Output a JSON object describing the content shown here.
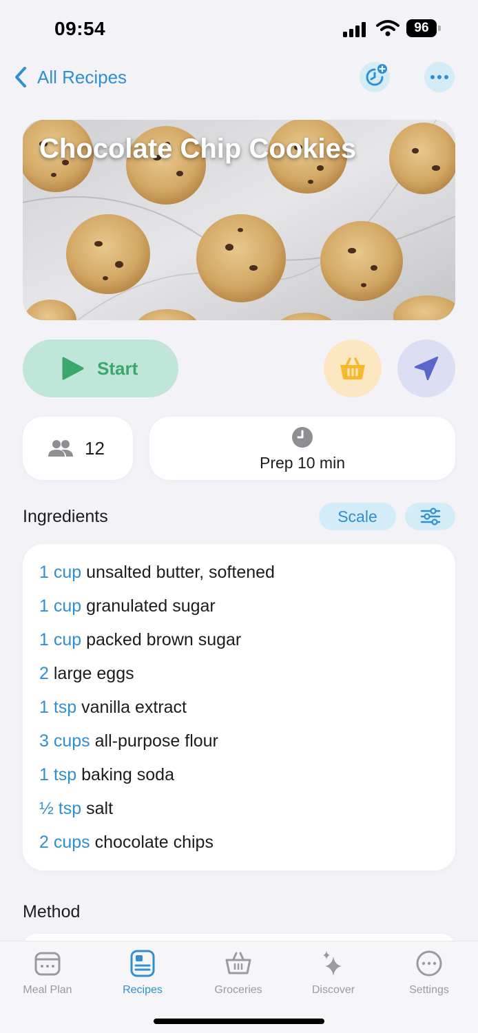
{
  "status_bar": {
    "time": "09:54",
    "battery": "96",
    "icons": [
      "signal-icon",
      "wifi-icon",
      "battery-icon"
    ]
  },
  "nav": {
    "back_label": "All Recipes",
    "back_icon": "chevron-left-icon",
    "actions": [
      "timer-add-icon",
      "more-icon"
    ]
  },
  "recipe": {
    "title": "Chocolate Chip Cookies",
    "start_label": "Start",
    "servings": "12",
    "prep": "Prep 10 min"
  },
  "ingredients": {
    "title": "Ingredients",
    "scale_label": "Scale",
    "items": [
      {
        "qty": "1 cup",
        "name": "unsalted butter, softened"
      },
      {
        "qty": "1 cup",
        "name": "granulated sugar"
      },
      {
        "qty": "1 cup",
        "name": "packed brown sugar"
      },
      {
        "qty": "2",
        "name": "large eggs"
      },
      {
        "qty": "1 tsp",
        "name": "vanilla extract"
      },
      {
        "qty": "3 cups",
        "name": "all-purpose flour"
      },
      {
        "qty": "1 tsp",
        "name": "baking soda"
      },
      {
        "qty": "½ tsp",
        "name": "salt"
      },
      {
        "qty": "2 cups",
        "name": "chocolate chips"
      }
    ]
  },
  "method": {
    "title": "Method"
  },
  "tabs": [
    {
      "label": "Meal Plan",
      "icon": "calendar-icon",
      "active": false
    },
    {
      "label": "Recipes",
      "icon": "recipe-book-icon",
      "active": true
    },
    {
      "label": "Groceries",
      "icon": "basket-icon",
      "active": false
    },
    {
      "label": "Discover",
      "icon": "sparkle-icon",
      "active": false
    },
    {
      "label": "Settings",
      "icon": "settings-icon",
      "active": false
    }
  ],
  "colors": {
    "accent": "#2f8fcf",
    "start_green": "#3aa76d",
    "basket_orange": "#f5b92e",
    "send_indigo": "#5a66c9",
    "background": "#f2f2f7"
  }
}
